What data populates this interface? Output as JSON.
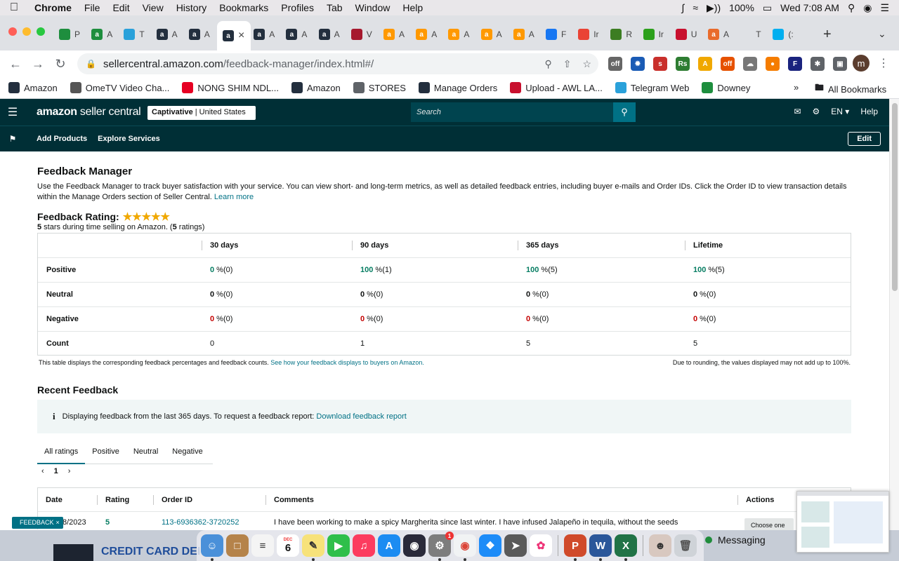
{
  "menubar": {
    "app": "Chrome",
    "items": [
      "File",
      "Edit",
      "View",
      "History",
      "Bookmarks",
      "Profiles",
      "Tab",
      "Window",
      "Help"
    ],
    "battery": "100%",
    "clock": "Wed 7:08 AM"
  },
  "tabs": [
    {
      "letter": "P",
      "icon": "sheets-icon",
      "color": "#1e8e3e"
    },
    {
      "letter": "A",
      "icon": "sheets-icon",
      "color": "#1e8e3e"
    },
    {
      "letter": "T",
      "icon": "telegram-icon",
      "color": "#2aa1da"
    },
    {
      "letter": "A",
      "icon": "amazon-icon",
      "color": "#232f3e"
    },
    {
      "letter": "A",
      "icon": "amazon-icon",
      "color": "#232f3e"
    },
    {
      "letter": "A",
      "icon": "amazon-icon",
      "color": "#232f3e"
    },
    {
      "letter": "A",
      "icon": "amazon-icon",
      "color": "#232f3e"
    },
    {
      "letter": "A",
      "icon": "amazon-icon",
      "color": "#232f3e"
    },
    {
      "letter": "A",
      "icon": "amazon-icon",
      "color": "#232f3e"
    },
    {
      "letter": "V",
      "icon": "walmart-icon",
      "color": "#a6192e"
    },
    {
      "letter": "A",
      "icon": "amazon-smile-icon",
      "color": "#ff9900"
    },
    {
      "letter": "A",
      "icon": "amazon-smile-icon",
      "color": "#ff9900"
    },
    {
      "letter": "A",
      "icon": "amazon-smile-icon",
      "color": "#ff9900"
    },
    {
      "letter": "A",
      "icon": "amazon-smile-icon",
      "color": "#ff9900"
    },
    {
      "letter": "A",
      "icon": "amazon-smile-icon",
      "color": "#ff9900"
    },
    {
      "letter": "F",
      "icon": "facebook-icon",
      "color": "#1877f2"
    },
    {
      "letter": "Ir",
      "icon": "gmail-icon",
      "color": "#ea4335"
    },
    {
      "letter": "R",
      "icon": "download-icon",
      "color": "#3c7d22"
    },
    {
      "letter": "Ir",
      "icon": "quickbooks-icon",
      "color": "#2ca01c"
    },
    {
      "letter": "U",
      "icon": "upload-icon",
      "color": "#c8102e"
    },
    {
      "letter": "A",
      "icon": "app-icon",
      "color": "#e96b2b"
    },
    {
      "letter": "T",
      "icon": "blank-icon",
      "color": "#dfe1e5"
    },
    {
      "letter": "(:",
      "icon": "skype-icon",
      "color": "#00aff0"
    }
  ],
  "address": {
    "host": "sellercentral.amazon.com",
    "path": "/feedback-manager/index.html#/"
  },
  "bookmarks": [
    {
      "label": "Amazon",
      "icon": "amazon-icon",
      "color": "#232f3e"
    },
    {
      "label": "OmeTV Video Cha...",
      "icon": "ometv-icon",
      "color": "#555"
    },
    {
      "label": "NONG SHIM NDL...",
      "icon": "pinterest-icon",
      "color": "#e60023"
    },
    {
      "label": "Amazon",
      "icon": "amazon-icon",
      "color": "#232f3e"
    },
    {
      "label": "STORES",
      "icon": "folder-icon",
      "color": "#5f6368"
    },
    {
      "label": "Manage Orders",
      "icon": "amazon-icon",
      "color": "#232f3e"
    },
    {
      "label": "Upload - AWL LA...",
      "icon": "upload-icon",
      "color": "#c8102e"
    },
    {
      "label": "Telegram Web",
      "icon": "telegram-icon",
      "color": "#2aa1da"
    },
    {
      "label": "Downey",
      "icon": "sheets-icon",
      "color": "#1e8e3e"
    }
  ],
  "bookmarks_more": "»",
  "all_bookmarks": "All Bookmarks",
  "sc": {
    "logo_main": "amazon",
    "logo_sub": " seller central",
    "account_store": "Captivative",
    "account_region": " | United States",
    "search_placeholder": "Search",
    "language": "EN",
    "help": "Help",
    "nav": [
      "Add Products",
      "Explore Services"
    ],
    "edit": "Edit"
  },
  "page": {
    "title": "Feedback Manager",
    "intro": "Use the Feedback Manager to track buyer satisfaction with your service. You can view short- and long-term metrics, as well as detailed feedback entries, including buyer e-mails and Order IDs. Click the Order ID to view transaction details within the Manage Orders section of Seller Central.",
    "learn_more": "Learn more",
    "rating_label": "Feedback Rating:",
    "rating_stars": 5,
    "rating_sub_stars": "5",
    "rating_sub_mid": " stars during time selling on Amazon. (",
    "rating_sub_count": "5",
    "rating_sub_end": " ratings)"
  },
  "metrics": {
    "columns": [
      "30 days",
      "90 days",
      "365 days",
      "Lifetime"
    ],
    "rows": [
      {
        "label": "Positive",
        "cells": [
          {
            "v": "0",
            "s": " %(0)"
          },
          {
            "v": "100",
            "s": " %(1)"
          },
          {
            "v": "100",
            "s": " %(5)"
          },
          {
            "v": "100",
            "s": " %(5)"
          }
        ]
      },
      {
        "label": "Neutral",
        "cells": [
          {
            "v": "0",
            "s": " %(0)"
          },
          {
            "v": "0",
            "s": " %(0)"
          },
          {
            "v": "0",
            "s": " %(0)"
          },
          {
            "v": "0",
            "s": " %(0)"
          }
        ]
      },
      {
        "label": "Negative",
        "cells": [
          {
            "v": "0",
            "s": " %(0)"
          },
          {
            "v": "0",
            "s": " %(0)"
          },
          {
            "v": "0",
            "s": " %(0)"
          },
          {
            "v": "0",
            "s": " %(0)"
          }
        ]
      },
      {
        "label": "Count",
        "cells": [
          {
            "v": "0",
            "s": ""
          },
          {
            "v": "1",
            "s": ""
          },
          {
            "v": "5",
            "s": ""
          },
          {
            "v": "5",
            "s": ""
          }
        ]
      }
    ],
    "note_left": "This table displays the corresponding feedback percentages and feedback counts.",
    "note_link": "See how your feedback displays to buyers on Amazon.",
    "note_right": "Due to rounding, the values displayed may not add up to 100%."
  },
  "recent": {
    "title": "Recent Feedback",
    "info_text": "Displaying feedback from the last 365 days. To request a feedback report:",
    "info_link": "Download feedback report",
    "tabs": [
      "All ratings",
      "Positive",
      "Neutral",
      "Negative"
    ],
    "page": "1",
    "columns": [
      "Date",
      "Rating",
      "Order ID",
      "Comments",
      "Actions"
    ],
    "row": {
      "date": "8/2023",
      "rating": "5",
      "order_id": "113-6936362-3720252",
      "comment": "I have been working to make a spicy Margherita since last winter. I have infused Jalapeño in tequila, without the seeds",
      "action": "Choose one"
    }
  },
  "feedback_tab": "FEEDBACK",
  "behind": {
    "text": "CREDIT CARD DEI"
  },
  "dock": {
    "calendar_day": "6",
    "calendar_month": "DEC",
    "badge": "1"
  },
  "messaging": "Messaging"
}
